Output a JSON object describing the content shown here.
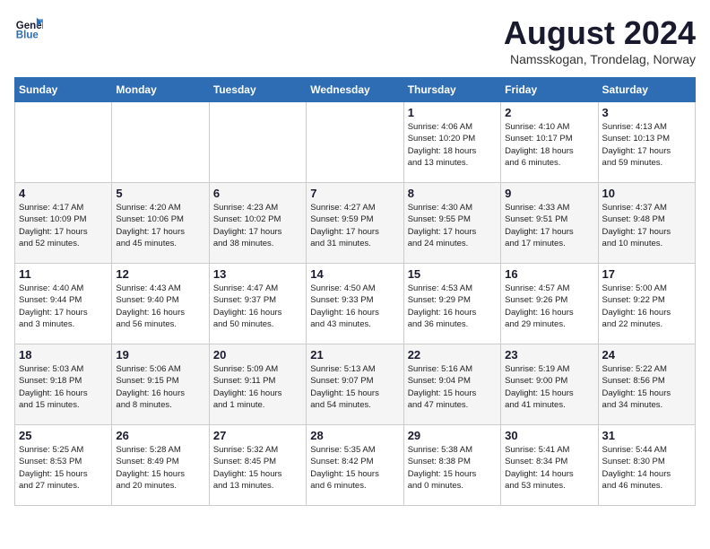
{
  "logo": {
    "line1": "General",
    "line2": "Blue"
  },
  "title": "August 2024",
  "subtitle": "Namsskogan, Trondelag, Norway",
  "days_of_week": [
    "Sunday",
    "Monday",
    "Tuesday",
    "Wednesday",
    "Thursday",
    "Friday",
    "Saturday"
  ],
  "weeks": [
    [
      {
        "num": "",
        "info": ""
      },
      {
        "num": "",
        "info": ""
      },
      {
        "num": "",
        "info": ""
      },
      {
        "num": "",
        "info": ""
      },
      {
        "num": "1",
        "info": "Sunrise: 4:06 AM\nSunset: 10:20 PM\nDaylight: 18 hours\nand 13 minutes."
      },
      {
        "num": "2",
        "info": "Sunrise: 4:10 AM\nSunset: 10:17 PM\nDaylight: 18 hours\nand 6 minutes."
      },
      {
        "num": "3",
        "info": "Sunrise: 4:13 AM\nSunset: 10:13 PM\nDaylight: 17 hours\nand 59 minutes."
      }
    ],
    [
      {
        "num": "4",
        "info": "Sunrise: 4:17 AM\nSunset: 10:09 PM\nDaylight: 17 hours\nand 52 minutes."
      },
      {
        "num": "5",
        "info": "Sunrise: 4:20 AM\nSunset: 10:06 PM\nDaylight: 17 hours\nand 45 minutes."
      },
      {
        "num": "6",
        "info": "Sunrise: 4:23 AM\nSunset: 10:02 PM\nDaylight: 17 hours\nand 38 minutes."
      },
      {
        "num": "7",
        "info": "Sunrise: 4:27 AM\nSunset: 9:59 PM\nDaylight: 17 hours\nand 31 minutes."
      },
      {
        "num": "8",
        "info": "Sunrise: 4:30 AM\nSunset: 9:55 PM\nDaylight: 17 hours\nand 24 minutes."
      },
      {
        "num": "9",
        "info": "Sunrise: 4:33 AM\nSunset: 9:51 PM\nDaylight: 17 hours\nand 17 minutes."
      },
      {
        "num": "10",
        "info": "Sunrise: 4:37 AM\nSunset: 9:48 PM\nDaylight: 17 hours\nand 10 minutes."
      }
    ],
    [
      {
        "num": "11",
        "info": "Sunrise: 4:40 AM\nSunset: 9:44 PM\nDaylight: 17 hours\nand 3 minutes."
      },
      {
        "num": "12",
        "info": "Sunrise: 4:43 AM\nSunset: 9:40 PM\nDaylight: 16 hours\nand 56 minutes."
      },
      {
        "num": "13",
        "info": "Sunrise: 4:47 AM\nSunset: 9:37 PM\nDaylight: 16 hours\nand 50 minutes."
      },
      {
        "num": "14",
        "info": "Sunrise: 4:50 AM\nSunset: 9:33 PM\nDaylight: 16 hours\nand 43 minutes."
      },
      {
        "num": "15",
        "info": "Sunrise: 4:53 AM\nSunset: 9:29 PM\nDaylight: 16 hours\nand 36 minutes."
      },
      {
        "num": "16",
        "info": "Sunrise: 4:57 AM\nSunset: 9:26 PM\nDaylight: 16 hours\nand 29 minutes."
      },
      {
        "num": "17",
        "info": "Sunrise: 5:00 AM\nSunset: 9:22 PM\nDaylight: 16 hours\nand 22 minutes."
      }
    ],
    [
      {
        "num": "18",
        "info": "Sunrise: 5:03 AM\nSunset: 9:18 PM\nDaylight: 16 hours\nand 15 minutes."
      },
      {
        "num": "19",
        "info": "Sunrise: 5:06 AM\nSunset: 9:15 PM\nDaylight: 16 hours\nand 8 minutes."
      },
      {
        "num": "20",
        "info": "Sunrise: 5:09 AM\nSunset: 9:11 PM\nDaylight: 16 hours\nand 1 minute."
      },
      {
        "num": "21",
        "info": "Sunrise: 5:13 AM\nSunset: 9:07 PM\nDaylight: 15 hours\nand 54 minutes."
      },
      {
        "num": "22",
        "info": "Sunrise: 5:16 AM\nSunset: 9:04 PM\nDaylight: 15 hours\nand 47 minutes."
      },
      {
        "num": "23",
        "info": "Sunrise: 5:19 AM\nSunset: 9:00 PM\nDaylight: 15 hours\nand 41 minutes."
      },
      {
        "num": "24",
        "info": "Sunrise: 5:22 AM\nSunset: 8:56 PM\nDaylight: 15 hours\nand 34 minutes."
      }
    ],
    [
      {
        "num": "25",
        "info": "Sunrise: 5:25 AM\nSunset: 8:53 PM\nDaylight: 15 hours\nand 27 minutes."
      },
      {
        "num": "26",
        "info": "Sunrise: 5:28 AM\nSunset: 8:49 PM\nDaylight: 15 hours\nand 20 minutes."
      },
      {
        "num": "27",
        "info": "Sunrise: 5:32 AM\nSunset: 8:45 PM\nDaylight: 15 hours\nand 13 minutes."
      },
      {
        "num": "28",
        "info": "Sunrise: 5:35 AM\nSunset: 8:42 PM\nDaylight: 15 hours\nand 6 minutes."
      },
      {
        "num": "29",
        "info": "Sunrise: 5:38 AM\nSunset: 8:38 PM\nDaylight: 15 hours\nand 0 minutes."
      },
      {
        "num": "30",
        "info": "Sunrise: 5:41 AM\nSunset: 8:34 PM\nDaylight: 14 hours\nand 53 minutes."
      },
      {
        "num": "31",
        "info": "Sunrise: 5:44 AM\nSunset: 8:30 PM\nDaylight: 14 hours\nand 46 minutes."
      }
    ]
  ]
}
